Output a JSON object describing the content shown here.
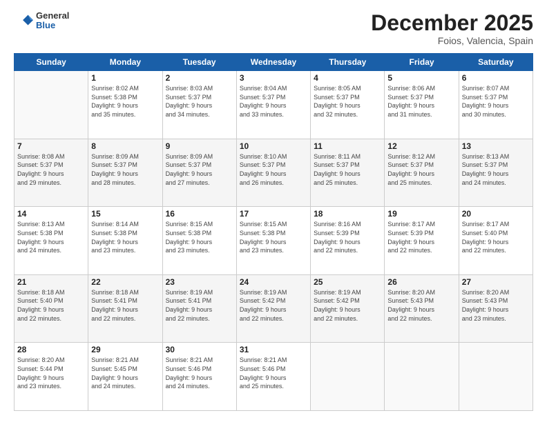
{
  "header": {
    "logo": {
      "general": "General",
      "blue": "Blue"
    },
    "title": "December 2025",
    "subtitle": "Foios, Valencia, Spain"
  },
  "calendar": {
    "weekdays": [
      "Sunday",
      "Monday",
      "Tuesday",
      "Wednesday",
      "Thursday",
      "Friday",
      "Saturday"
    ],
    "weeks": [
      [
        {
          "day": "",
          "info": ""
        },
        {
          "day": "1",
          "info": "Sunrise: 8:02 AM\nSunset: 5:38 PM\nDaylight: 9 hours\nand 35 minutes."
        },
        {
          "day": "2",
          "info": "Sunrise: 8:03 AM\nSunset: 5:37 PM\nDaylight: 9 hours\nand 34 minutes."
        },
        {
          "day": "3",
          "info": "Sunrise: 8:04 AM\nSunset: 5:37 PM\nDaylight: 9 hours\nand 33 minutes."
        },
        {
          "day": "4",
          "info": "Sunrise: 8:05 AM\nSunset: 5:37 PM\nDaylight: 9 hours\nand 32 minutes."
        },
        {
          "day": "5",
          "info": "Sunrise: 8:06 AM\nSunset: 5:37 PM\nDaylight: 9 hours\nand 31 minutes."
        },
        {
          "day": "6",
          "info": "Sunrise: 8:07 AM\nSunset: 5:37 PM\nDaylight: 9 hours\nand 30 minutes."
        }
      ],
      [
        {
          "day": "7",
          "info": "Sunrise: 8:08 AM\nSunset: 5:37 PM\nDaylight: 9 hours\nand 29 minutes."
        },
        {
          "day": "8",
          "info": "Sunrise: 8:09 AM\nSunset: 5:37 PM\nDaylight: 9 hours\nand 28 minutes."
        },
        {
          "day": "9",
          "info": "Sunrise: 8:09 AM\nSunset: 5:37 PM\nDaylight: 9 hours\nand 27 minutes."
        },
        {
          "day": "10",
          "info": "Sunrise: 8:10 AM\nSunset: 5:37 PM\nDaylight: 9 hours\nand 26 minutes."
        },
        {
          "day": "11",
          "info": "Sunrise: 8:11 AM\nSunset: 5:37 PM\nDaylight: 9 hours\nand 25 minutes."
        },
        {
          "day": "12",
          "info": "Sunrise: 8:12 AM\nSunset: 5:37 PM\nDaylight: 9 hours\nand 25 minutes."
        },
        {
          "day": "13",
          "info": "Sunrise: 8:13 AM\nSunset: 5:37 PM\nDaylight: 9 hours\nand 24 minutes."
        }
      ],
      [
        {
          "day": "14",
          "info": "Sunrise: 8:13 AM\nSunset: 5:38 PM\nDaylight: 9 hours\nand 24 minutes."
        },
        {
          "day": "15",
          "info": "Sunrise: 8:14 AM\nSunset: 5:38 PM\nDaylight: 9 hours\nand 23 minutes."
        },
        {
          "day": "16",
          "info": "Sunrise: 8:15 AM\nSunset: 5:38 PM\nDaylight: 9 hours\nand 23 minutes."
        },
        {
          "day": "17",
          "info": "Sunrise: 8:15 AM\nSunset: 5:38 PM\nDaylight: 9 hours\nand 23 minutes."
        },
        {
          "day": "18",
          "info": "Sunrise: 8:16 AM\nSunset: 5:39 PM\nDaylight: 9 hours\nand 22 minutes."
        },
        {
          "day": "19",
          "info": "Sunrise: 8:17 AM\nSunset: 5:39 PM\nDaylight: 9 hours\nand 22 minutes."
        },
        {
          "day": "20",
          "info": "Sunrise: 8:17 AM\nSunset: 5:40 PM\nDaylight: 9 hours\nand 22 minutes."
        }
      ],
      [
        {
          "day": "21",
          "info": "Sunrise: 8:18 AM\nSunset: 5:40 PM\nDaylight: 9 hours\nand 22 minutes."
        },
        {
          "day": "22",
          "info": "Sunrise: 8:18 AM\nSunset: 5:41 PM\nDaylight: 9 hours\nand 22 minutes."
        },
        {
          "day": "23",
          "info": "Sunrise: 8:19 AM\nSunset: 5:41 PM\nDaylight: 9 hours\nand 22 minutes."
        },
        {
          "day": "24",
          "info": "Sunrise: 8:19 AM\nSunset: 5:42 PM\nDaylight: 9 hours\nand 22 minutes."
        },
        {
          "day": "25",
          "info": "Sunrise: 8:19 AM\nSunset: 5:42 PM\nDaylight: 9 hours\nand 22 minutes."
        },
        {
          "day": "26",
          "info": "Sunrise: 8:20 AM\nSunset: 5:43 PM\nDaylight: 9 hours\nand 22 minutes."
        },
        {
          "day": "27",
          "info": "Sunrise: 8:20 AM\nSunset: 5:43 PM\nDaylight: 9 hours\nand 23 minutes."
        }
      ],
      [
        {
          "day": "28",
          "info": "Sunrise: 8:20 AM\nSunset: 5:44 PM\nDaylight: 9 hours\nand 23 minutes."
        },
        {
          "day": "29",
          "info": "Sunrise: 8:21 AM\nSunset: 5:45 PM\nDaylight: 9 hours\nand 24 minutes."
        },
        {
          "day": "30",
          "info": "Sunrise: 8:21 AM\nSunset: 5:46 PM\nDaylight: 9 hours\nand 24 minutes."
        },
        {
          "day": "31",
          "info": "Sunrise: 8:21 AM\nSunset: 5:46 PM\nDaylight: 9 hours\nand 25 minutes."
        },
        {
          "day": "",
          "info": ""
        },
        {
          "day": "",
          "info": ""
        },
        {
          "day": "",
          "info": ""
        }
      ]
    ]
  }
}
